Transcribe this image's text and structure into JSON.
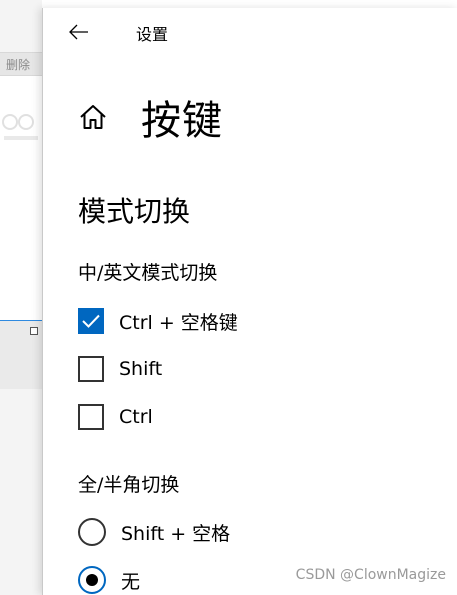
{
  "background": {
    "toolbar_label": "删除"
  },
  "titlebar": {
    "back_icon": "back-arrow-icon",
    "title": "设置"
  },
  "header": {
    "home_icon": "home-icon",
    "title": "按键"
  },
  "section": {
    "title": "模式切换"
  },
  "group1": {
    "label": "中/英文模式切换",
    "options": [
      {
        "label": "Ctrl + 空格键",
        "checked": true
      },
      {
        "label": "Shift",
        "checked": false
      },
      {
        "label": "Ctrl",
        "checked": false
      }
    ]
  },
  "group2": {
    "label": "全/半角切换",
    "options": [
      {
        "label": "Shift + 空格",
        "selected": false
      },
      {
        "label": "无",
        "selected": true
      }
    ]
  },
  "colors": {
    "accent": "#0067c0"
  },
  "watermark": "CSDN @ClownMagize"
}
